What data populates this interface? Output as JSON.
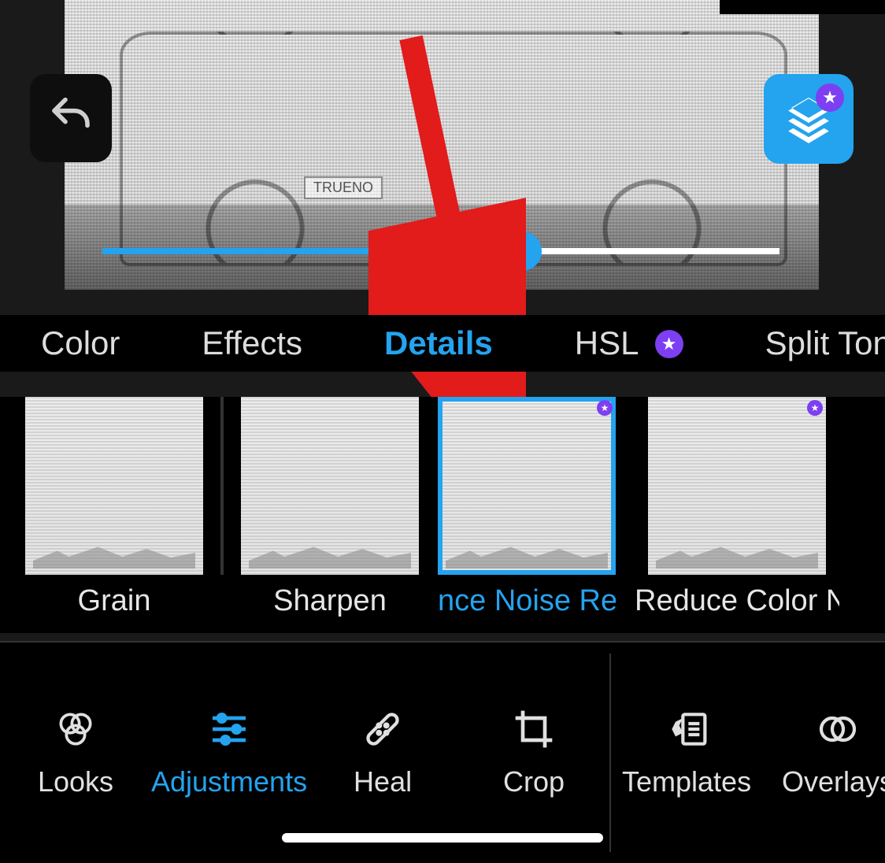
{
  "preview": {
    "license_plate": "TRUENO",
    "slider_percent": 62
  },
  "annotation": {
    "type": "arrow",
    "color": "#e21b1b"
  },
  "subtabs": {
    "items": [
      {
        "label": "Color",
        "active": false,
        "premium": false
      },
      {
        "label": "Effects",
        "active": false,
        "premium": false
      },
      {
        "label": "Details",
        "active": true,
        "premium": false
      },
      {
        "label": "HSL",
        "active": false,
        "premium": true
      },
      {
        "label": "Split Tone",
        "active": false,
        "premium": false
      }
    ]
  },
  "detail_tools": {
    "items": [
      {
        "label": "Grain",
        "selected": false,
        "premium": false
      },
      {
        "label": "Sharpen",
        "selected": false,
        "premium": false
      },
      {
        "label": "Reduce Luminance Noise",
        "selected": true,
        "premium": true,
        "visible_label": "nce Noise    Rec"
      },
      {
        "label": "Reduce Color Noise",
        "selected": false,
        "premium": true,
        "visible_label": "Reduce Color N"
      }
    ]
  },
  "bottom_nav": {
    "items": [
      {
        "label": "Looks",
        "active": false
      },
      {
        "label": "Adjustments",
        "active": true
      },
      {
        "label": "Heal",
        "active": false
      },
      {
        "label": "Crop",
        "active": false
      },
      {
        "label": "Templates",
        "active": false
      },
      {
        "label": "Overlays",
        "active": false
      }
    ]
  },
  "colors": {
    "accent": "#24a3ef",
    "premium": "#7d3ff2"
  }
}
